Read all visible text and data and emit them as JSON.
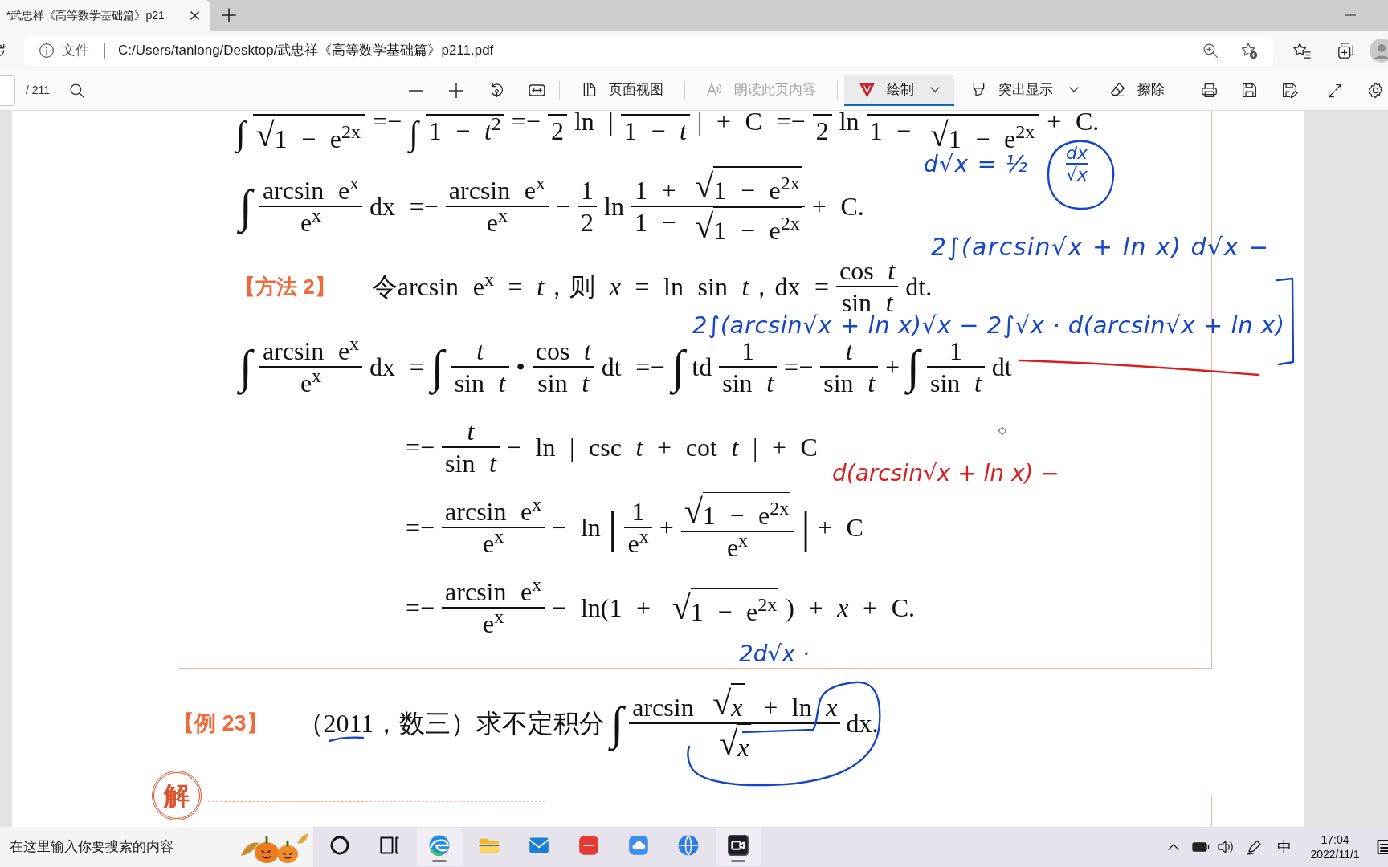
{
  "browser": {
    "tabs": [
      {
        "title": "*武忠祥《高等数学基础篇》p21",
        "selected": true
      }
    ]
  },
  "address_bar": {
    "site_label": "文件",
    "url": "C:/Users/tanlong/Desktop/武忠祥《高等数学基础篇》p211.pdf"
  },
  "pdf_toolbar": {
    "page_count": "/ 211",
    "groups": [
      [
        {
          "kind": "zoom-out"
        },
        {
          "kind": "zoom-in"
        },
        {
          "kind": "rotate"
        },
        {
          "kind": "fit-width"
        }
      ],
      [
        {
          "kind": "page-view",
          "label": "页面视图",
          "selected": false,
          "disabled": false,
          "dropdown": false
        }
      ],
      [
        {
          "kind": "read-aloud",
          "label": "朗读此页内容",
          "selected": false,
          "disabled": true,
          "dropdown": false
        }
      ],
      [
        {
          "kind": "draw",
          "label": "绘制",
          "selected": true,
          "disabled": false,
          "dropdown": true
        },
        {
          "kind": "highlight",
          "label": "突出显示",
          "selected": false,
          "disabled": false,
          "dropdown": true
        },
        {
          "kind": "erase",
          "label": "擦除",
          "selected": false,
          "disabled": false,
          "dropdown": false
        }
      ],
      [
        {
          "kind": "print"
        },
        {
          "kind": "save"
        },
        {
          "kind": "save-as"
        }
      ],
      [
        {
          "kind": "fullscreen"
        },
        {
          "kind": "settings"
        }
      ]
    ]
  },
  "document": {
    "solution_lines": [
      {
        "kind": "cut",
        "parts": [
          {
            "kind": "big",
            "text": "∫"
          },
          {
            "kind": "frac",
            "den": [
              {
                "kind": "sqrt",
                "sign": "√",
                "body": [
                  "1 − e$^{2x}$"
                ]
              }
            ]
          },
          "=−",
          {
            "kind": "big",
            "text": "∫"
          },
          {
            "kind": "frac",
            "den": [
              "1 − *t*$^{2}$"
            ]
          },
          "=−",
          {
            "kind": "frac",
            "den": [
              "2"
            ]
          },
          "ln |",
          {
            "kind": "frac",
            "den": [
              "1 − *t*"
            ]
          },
          "| + C =−",
          {
            "kind": "frac",
            "den": [
              "2"
            ]
          },
          "ln",
          {
            "kind": "frac",
            "den": [
              "1 − ",
              {
                "kind": "sqrt",
                "sign": "√",
                "body": [
                  "1 − e$^{2x}$"
                ]
              }
            ]
          },
          "+ C."
        ]
      },
      {
        "kind": "equation",
        "parts": [
          {
            "kind": "big",
            "text": "∫"
          },
          {
            "kind": "frac",
            "num": [
              "arcsin e$^{x}$"
            ],
            "den": [
              "e$^{x}$"
            ]
          },
          "dx =−",
          {
            "kind": "frac",
            "num": [
              "arcsin e$^{x}$"
            ],
            "den": [
              "e$^{x}$"
            ]
          },
          "−",
          {
            "kind": "frac",
            "num": [
              "1"
            ],
            "den": [
              "2"
            ]
          },
          "ln",
          {
            "kind": "frac",
            "num": [
              "1 + ",
              {
                "kind": "sqrt",
                "sign": "√",
                "body": [
                  "1 − e$^{2x}$"
                ]
              }
            ],
            "den": [
              "1 − ",
              {
                "kind": "sqrt",
                "sign": "√",
                "body": [
                  "1 − e$^{2x}$"
                ]
              }
            ]
          },
          "+ C."
        ]
      },
      {
        "kind": "method",
        "label": "【方法 2】",
        "parts": [
          "令arcsin e$^{x}$ = *t*，则 *x* = ln sin *t*，dx =",
          {
            "kind": "frac",
            "num": [
              "cos *t*"
            ],
            "den": [
              "sin *t*"
            ]
          },
          "dt."
        ]
      },
      {
        "kind": "equation",
        "parts": [
          {
            "kind": "big",
            "text": "∫"
          },
          {
            "kind": "frac",
            "num": [
              "arcsin e$^{x}$"
            ],
            "den": [
              "e$^{x}$"
            ]
          },
          "dx =",
          {
            "kind": "big",
            "text": "∫"
          },
          {
            "kind": "frac",
            "num": [
              "*t*"
            ],
            "den": [
              "sin *t*"
            ]
          },
          "•",
          {
            "kind": "frac",
            "num": [
              "cos *t*"
            ],
            "den": [
              "sin *t*"
            ]
          },
          "dt =−",
          {
            "kind": "big",
            "text": "∫"
          },
          "td",
          {
            "kind": "frac",
            "num": [
              "1"
            ],
            "den": [
              "sin *t*"
            ]
          },
          "=−",
          {
            "kind": "frac",
            "num": [
              "*t*"
            ],
            "den": [
              "sin *t*"
            ]
          },
          "+",
          {
            "kind": "big",
            "text": "∫"
          },
          {
            "kind": "frac",
            "num": [
              "1"
            ],
            "den": [
              "sin *t*"
            ]
          },
          "dt"
        ]
      },
      {
        "kind": "continuation",
        "parts": [
          "=−",
          {
            "kind": "frac",
            "num": [
              "*t*"
            ],
            "den": [
              "sin *t*"
            ]
          },
          "− ln | csc *t* + cot *t* | + C"
        ]
      },
      {
        "kind": "continuation",
        "parts": [
          "=−",
          {
            "kind": "frac",
            "num": [
              "arcsin e$^{x}$"
            ],
            "den": [
              "e$^{x}$"
            ]
          },
          "− ln",
          {
            "kind": "big",
            "text": "|"
          },
          {
            "kind": "frac",
            "num": [
              "1"
            ],
            "den": [
              "e$^{x}$"
            ]
          },
          "+",
          {
            "kind": "frac",
            "num": [
              {
                "kind": "sqrt",
                "sign": "√",
                "body": [
                  "1 − e$^{2x}$"
                ]
              }
            ],
            "den": [
              "e$^{x}$"
            ]
          },
          {
            "kind": "big",
            "text": "|"
          },
          "+ C"
        ]
      },
      {
        "kind": "continuation",
        "parts": [
          "=−",
          {
            "kind": "frac",
            "num": [
              "arcsin e$^{x}$"
            ],
            "den": [
              "e$^{x}$"
            ]
          },
          "− ln(1 + ",
          {
            "kind": "sqrt",
            "sign": "√",
            "body": [
              "1 − e$^{2x}$"
            ]
          },
          ") + *x* + C."
        ]
      }
    ],
    "example": {
      "label": "【例 23】",
      "parts": [
        "（2011，数三）求不定积分",
        {
          "kind": "big",
          "text": "∫"
        },
        {
          "kind": "frac",
          "num": [
            "arcsin ",
            {
              "kind": "sqrt",
              "sign": "√",
              "body": [
                "*x*"
              ]
            },
            " + ln *x*"
          ],
          "den": [
            {
              "kind": "sqrt",
              "sign": "√",
              "body": [
                "*x*"
              ]
            }
          ]
        },
        "dx."
      ]
    },
    "next_solution": {
      "stamp": "解"
    }
  },
  "annotations": [
    {
      "kind": "text",
      "text": "d√x = ½",
      "color": "#1646c8"
    },
    {
      "kind": "fraction",
      "num": "dx",
      "den": "√x",
      "color": "#1646c8"
    },
    {
      "kind": "loop",
      "color": "#1646c8"
    },
    {
      "kind": "text",
      "text": "2∫(arcsin√x + ln x) d√x −",
      "color": "#1646c8"
    },
    {
      "kind": "text",
      "text": "2∫(arcsin√x + ln x)√x − 2∫√x · d(arcsin√x + ln x)",
      "color": "#1646c8"
    },
    {
      "kind": "bracket",
      "color": "#1646c8"
    },
    {
      "kind": "line",
      "color": "#d42020"
    },
    {
      "kind": "text",
      "text": "d(arcsin√x + ln x) −",
      "color": "#d42020"
    },
    {
      "kind": "text",
      "text": "2d√x ·",
      "color": "#1646c8"
    },
    {
      "kind": "line",
      "color": "#1646c8"
    },
    {
      "kind": "loop",
      "color": "#1646c8"
    }
  ],
  "taskbar": {
    "search_placeholder": "在这里输入你要搜索的内容",
    "apps": [
      {
        "kind": "ring",
        "running": false
      },
      {
        "kind": "task-view",
        "running": false
      },
      {
        "kind": "browser",
        "running": true
      },
      {
        "kind": "folder",
        "running": false
      },
      {
        "kind": "mail",
        "running": false
      },
      {
        "kind": "tile",
        "running": false
      },
      {
        "kind": "cloud",
        "running": false
      },
      {
        "kind": "globe",
        "running": false
      },
      {
        "kind": "camera",
        "running": true
      }
    ],
    "ime": "中",
    "time": "17:04",
    "date": "2022/11/1"
  }
}
